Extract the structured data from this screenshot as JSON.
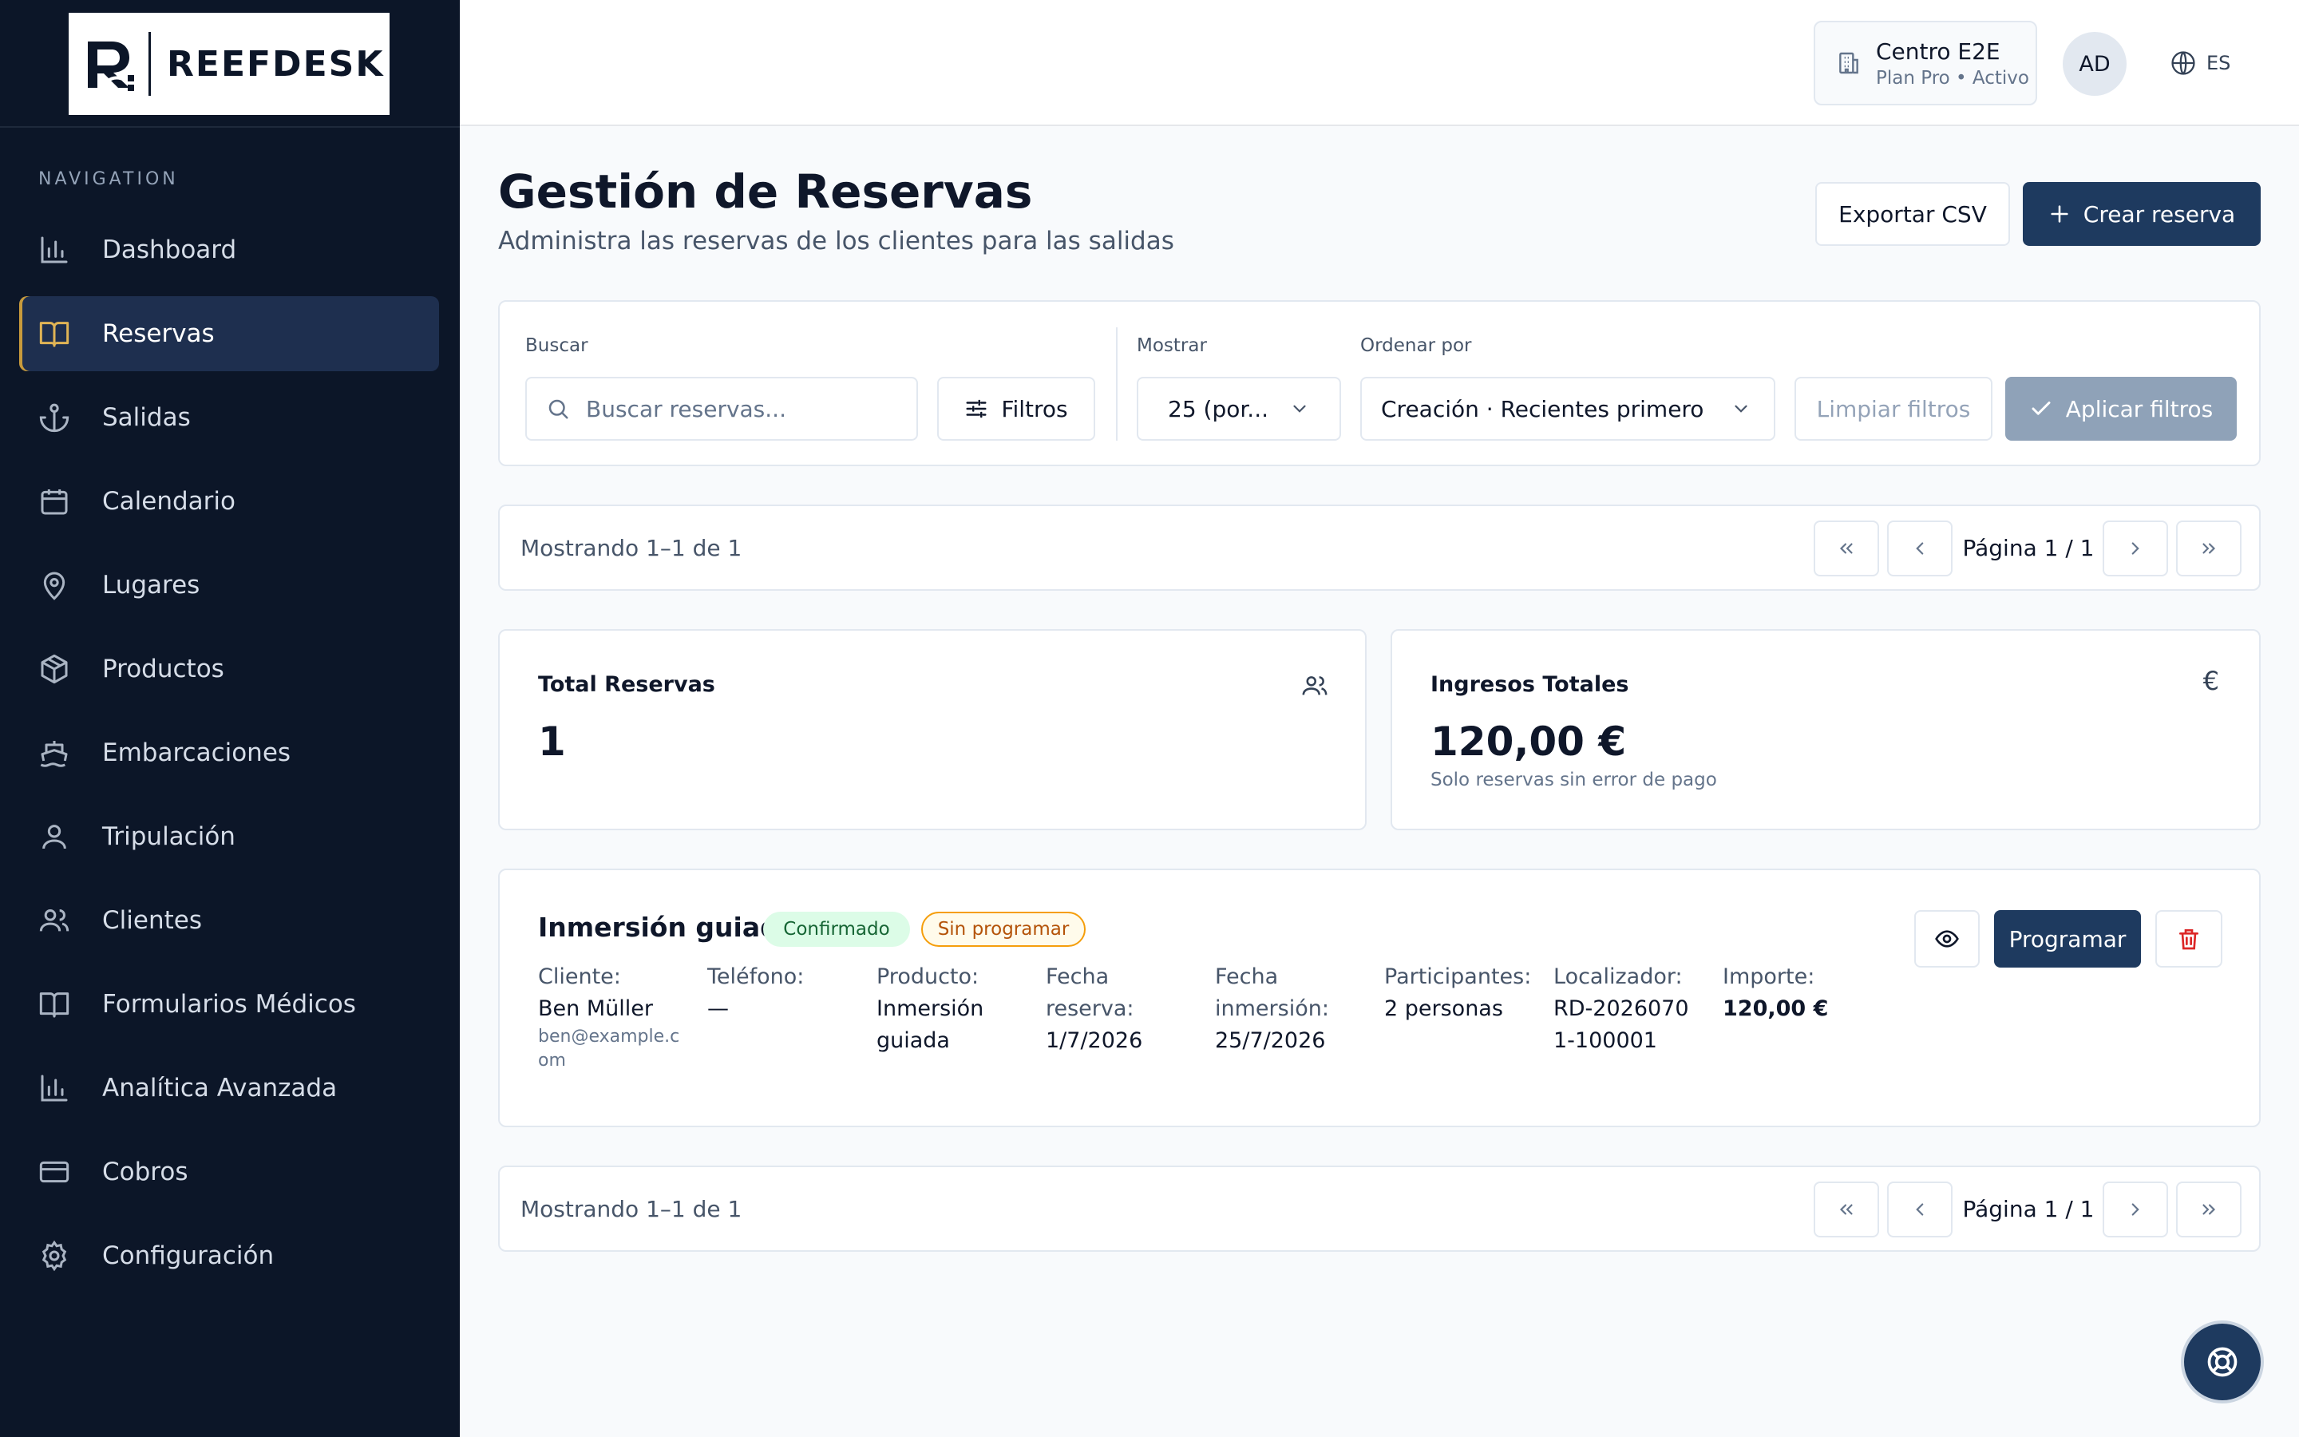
{
  "brand": {
    "name": "REEFDESK",
    "logo_icon": "reefdesk-logo"
  },
  "sidebar": {
    "heading": "NAVIGATION",
    "items": [
      {
        "label": "Dashboard",
        "icon": "bar-chart-icon",
        "active": false
      },
      {
        "label": "Reservas",
        "icon": "book-icon",
        "active": true
      },
      {
        "label": "Salidas",
        "icon": "anchor-icon",
        "active": false
      },
      {
        "label": "Calendario",
        "icon": "calendar-icon",
        "active": false
      },
      {
        "label": "Lugares",
        "icon": "map-pin-icon",
        "active": false
      },
      {
        "label": "Productos",
        "icon": "package-icon",
        "active": false
      },
      {
        "label": "Embarcaciones",
        "icon": "ship-icon",
        "active": false
      },
      {
        "label": "Tripulación",
        "icon": "user-icon",
        "active": false
      },
      {
        "label": "Clientes",
        "icon": "users-icon",
        "active": false
      },
      {
        "label": "Formularios Médicos",
        "icon": "book-open-icon",
        "active": false
      },
      {
        "label": "Analítica Avanzada",
        "icon": "bar-chart-icon",
        "active": false
      },
      {
        "label": "Cobros",
        "icon": "credit-card-icon",
        "active": false
      },
      {
        "label": "Configuración",
        "icon": "gear-icon",
        "active": false
      }
    ]
  },
  "topbar": {
    "tenant_name": "Centro E2E",
    "tenant_plan": "Plan Pro • Activo",
    "avatar_initials": "AD",
    "language": "ES"
  },
  "header": {
    "title": "Gestión de Reservas",
    "subtitle": "Administra las reservas de los clientes para las salidas",
    "export_label": "Exportar CSV",
    "create_label": "Crear reserva"
  },
  "filters": {
    "search_label": "Buscar",
    "search_placeholder": "Buscar reservas...",
    "filters_button": "Filtros",
    "show_label": "Mostrar",
    "show_value": "25 (por...",
    "sort_label": "Ordenar por",
    "sort_value": "Creación · Recientes primero",
    "clear_label": "Limpiar filtros",
    "apply_label": "Aplicar filtros"
  },
  "pagination": {
    "summary": "Mostrando 1–1 de 1",
    "page": "Página 1 / 1"
  },
  "stats": {
    "total_label": "Total Reservas",
    "total_value": "1",
    "revenue_label": "Ingresos Totales",
    "revenue_value": "120,00 €",
    "revenue_note": "Solo reservas sin error de pago",
    "revenue_symbol": "€"
  },
  "booking": {
    "title": "Inmersión guiada",
    "status_badge": "Confirmado",
    "schedule_badge": "Sin programar",
    "client_label": "Cliente:",
    "client_name": "Ben Müller",
    "client_email": "ben@example.com",
    "phone_label": "Teléfono:",
    "phone_value": "—",
    "product_label": "Producto:",
    "product_value": "Inmersión guiada",
    "booking_date_label": "Fecha reserva:",
    "booking_date_value": "1/7/2026",
    "dive_date_label": "Fecha inmersión:",
    "dive_date_value": "25/7/2026",
    "participants_label": "Participantes:",
    "participants_value": "2 personas",
    "locator_label": "Localizador:",
    "locator_value": "RD-20260701-100001",
    "amount_label": "Importe:",
    "amount_value": "120,00 €",
    "schedule_button": "Programar"
  },
  "colors": {
    "sidebar_bg": "#0c1628",
    "primary": "#1e3a5f",
    "active_accent": "#c89b3c",
    "badge_green": "#dcfce7",
    "badge_amber": "#f59e0b",
    "danger": "#dc2626"
  }
}
